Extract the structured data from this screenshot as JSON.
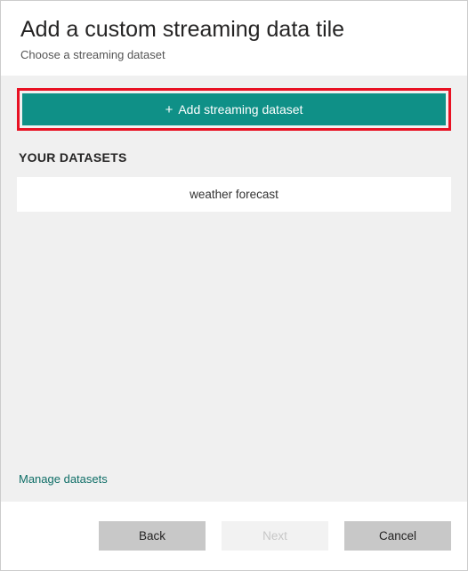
{
  "header": {
    "title": "Add a custom streaming data tile",
    "subtitle": "Choose a streaming dataset"
  },
  "add_button": {
    "label": "Add streaming dataset",
    "icon": "+"
  },
  "section": {
    "title": "YOUR DATASETS"
  },
  "datasets": [
    {
      "name": "weather forecast"
    }
  ],
  "links": {
    "manage": "Manage datasets"
  },
  "footer": {
    "back": "Back",
    "next": "Next",
    "cancel": "Cancel"
  }
}
